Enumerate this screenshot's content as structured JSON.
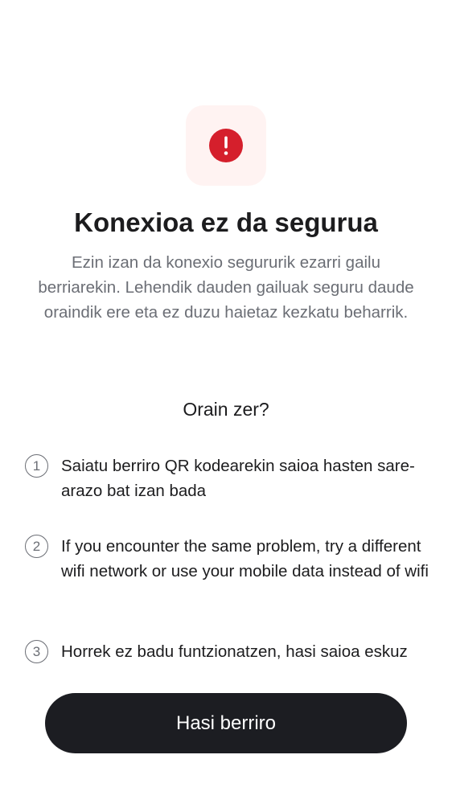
{
  "icon": {
    "name": "alert-circle-icon",
    "color": "#d51f2c",
    "tile_color": "#fff3f2"
  },
  "title": "Konexioa ez da segurua",
  "subtitle": "Ezin izan da konexio segururik ezarri gailu berriarekin. Lehendik dauden gailuak seguru daude oraindik ere eta ez duzu haietaz kezkatu beharrik.",
  "steps_heading": "Orain zer?",
  "steps": [
    {
      "number": "1",
      "text": "Saiatu berriro QR kodearekin saioa hasten sare-arazo bat izan bada"
    },
    {
      "number": "2",
      "text": "If you encounter the same problem, try a different wifi network or use your mobile data instead of wifi"
    },
    {
      "number": "3",
      "text": "Horrek ez badu funtzionatzen, hasi saioa eskuz"
    }
  ],
  "primary_button": {
    "label": "Hasi berriro",
    "color": "#1c1d22"
  }
}
